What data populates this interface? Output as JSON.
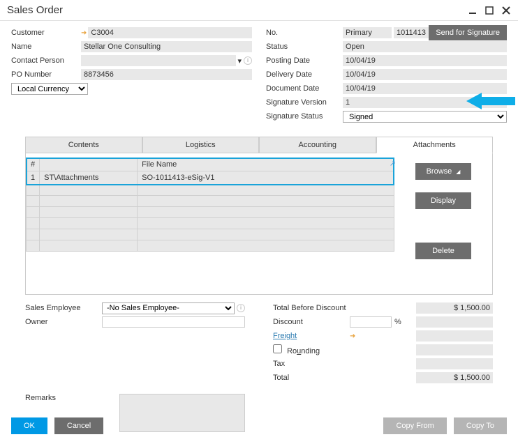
{
  "window": {
    "title": "Sales Order"
  },
  "left": {
    "customer_label": "Customer",
    "customer": "C3004",
    "name_label": "Name",
    "name": "Stellar One Consulting",
    "contact_label": "Contact Person",
    "po_label": "PO Number",
    "po": "8873456",
    "currency": "Local Currency"
  },
  "right": {
    "no_label": "No.",
    "no_type": "Primary",
    "no": "1011413",
    "status_label": "Status",
    "status": "Open",
    "posting_label": "Posting Date",
    "posting": "10/04/19",
    "delivery_label": "Delivery Date",
    "delivery": "10/04/19",
    "document_label": "Document Date",
    "document": "10/04/19",
    "sigver_label": "Signature Version",
    "sigver": "1",
    "sigstatus_label": "Signature Status",
    "sigstatus": "Signed"
  },
  "sig_button": "Send for Signature",
  "tabs": {
    "contents": "Contents",
    "logistics": "Logistics",
    "accounting": "Accounting",
    "attachments": "Attachments"
  },
  "grid": {
    "col_hash": "#",
    "col_file": "File Name",
    "row1_num": "1",
    "row1_path": "ST\\Attachments",
    "row1_file": "SO-1011413-eSig-V1"
  },
  "attach_btns": {
    "browse": "Browse",
    "display": "Display",
    "delete": "Delete"
  },
  "footer": {
    "salesemp_label": "Sales Employee",
    "salesemp": "-No Sales Employee-",
    "owner_label": "Owner",
    "tbd_label": "Total Before Discount",
    "tbd": "$ 1,500.00",
    "discount_label": "Discount",
    "pct_sym": "%",
    "freight_label": "Freight",
    "rounding_label": "Rounding",
    "tax_label": "Tax",
    "total_label": "Total",
    "total": "$ 1,500.00",
    "remarks_label": "Remarks"
  },
  "bottom": {
    "ok": "OK",
    "cancel": "Cancel",
    "copyfrom": "Copy From",
    "copyto": "Copy To"
  }
}
